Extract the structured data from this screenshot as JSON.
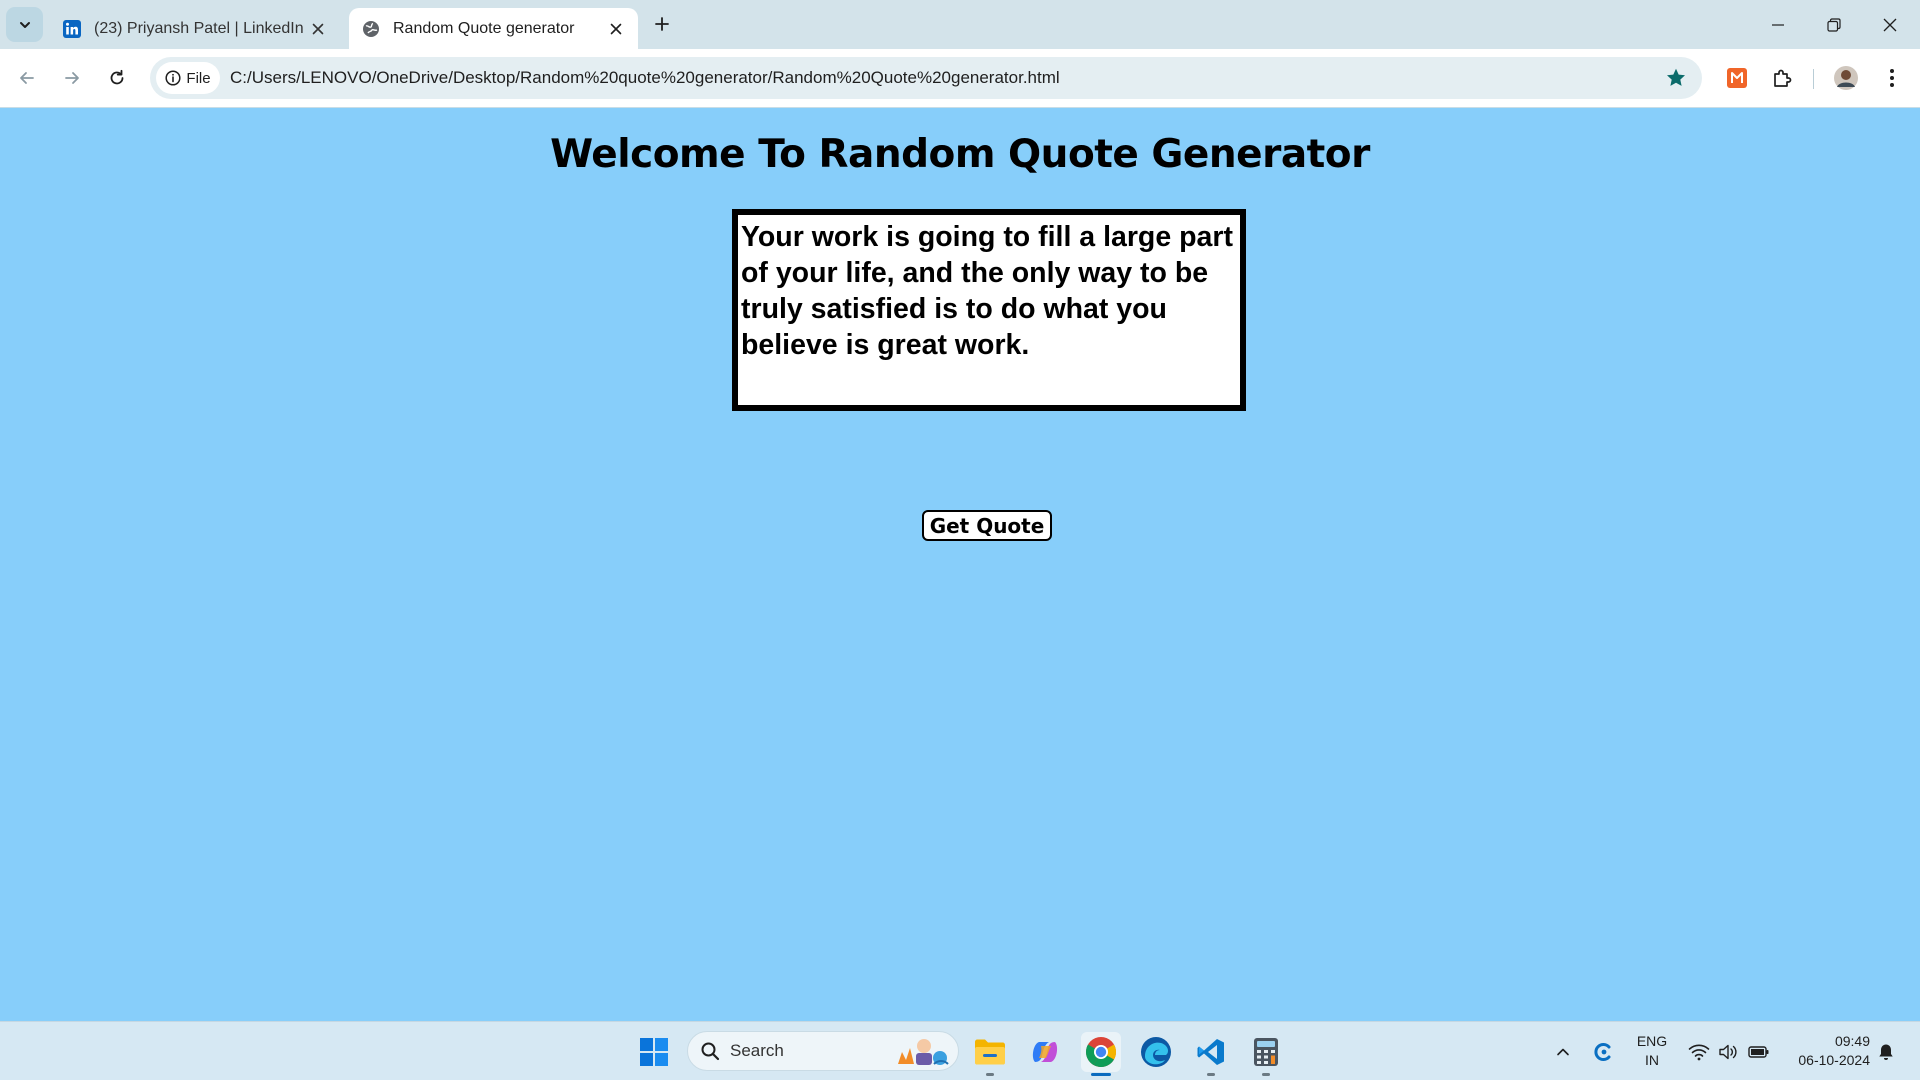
{
  "browser": {
    "tabs": [
      {
        "title": "(23) Priyansh Patel | LinkedIn",
        "active": false,
        "favicon": "linkedin-icon"
      },
      {
        "title": "Random Quote generator",
        "active": true,
        "favicon": "globe-icon"
      }
    ],
    "site_chip_label": "File",
    "url": "C:/Users/LENOVO/OneDrive/Desktop/Random%20quote%20generator/Random%20Quote%20generator.html",
    "accent_color": "#0b6b6b"
  },
  "page": {
    "heading": "Welcome To Random Quote Generator",
    "quote": "Your work is going to fill a large part of your life, and the only way to be truly satisfied is to do what you believe is great work.",
    "button_label": "Get Quote",
    "background_color": "#87cefa"
  },
  "taskbar": {
    "search_label": "Search",
    "lang_line1": "ENG",
    "lang_line2": "IN",
    "time": "09:49",
    "date": "06-10-2024"
  }
}
